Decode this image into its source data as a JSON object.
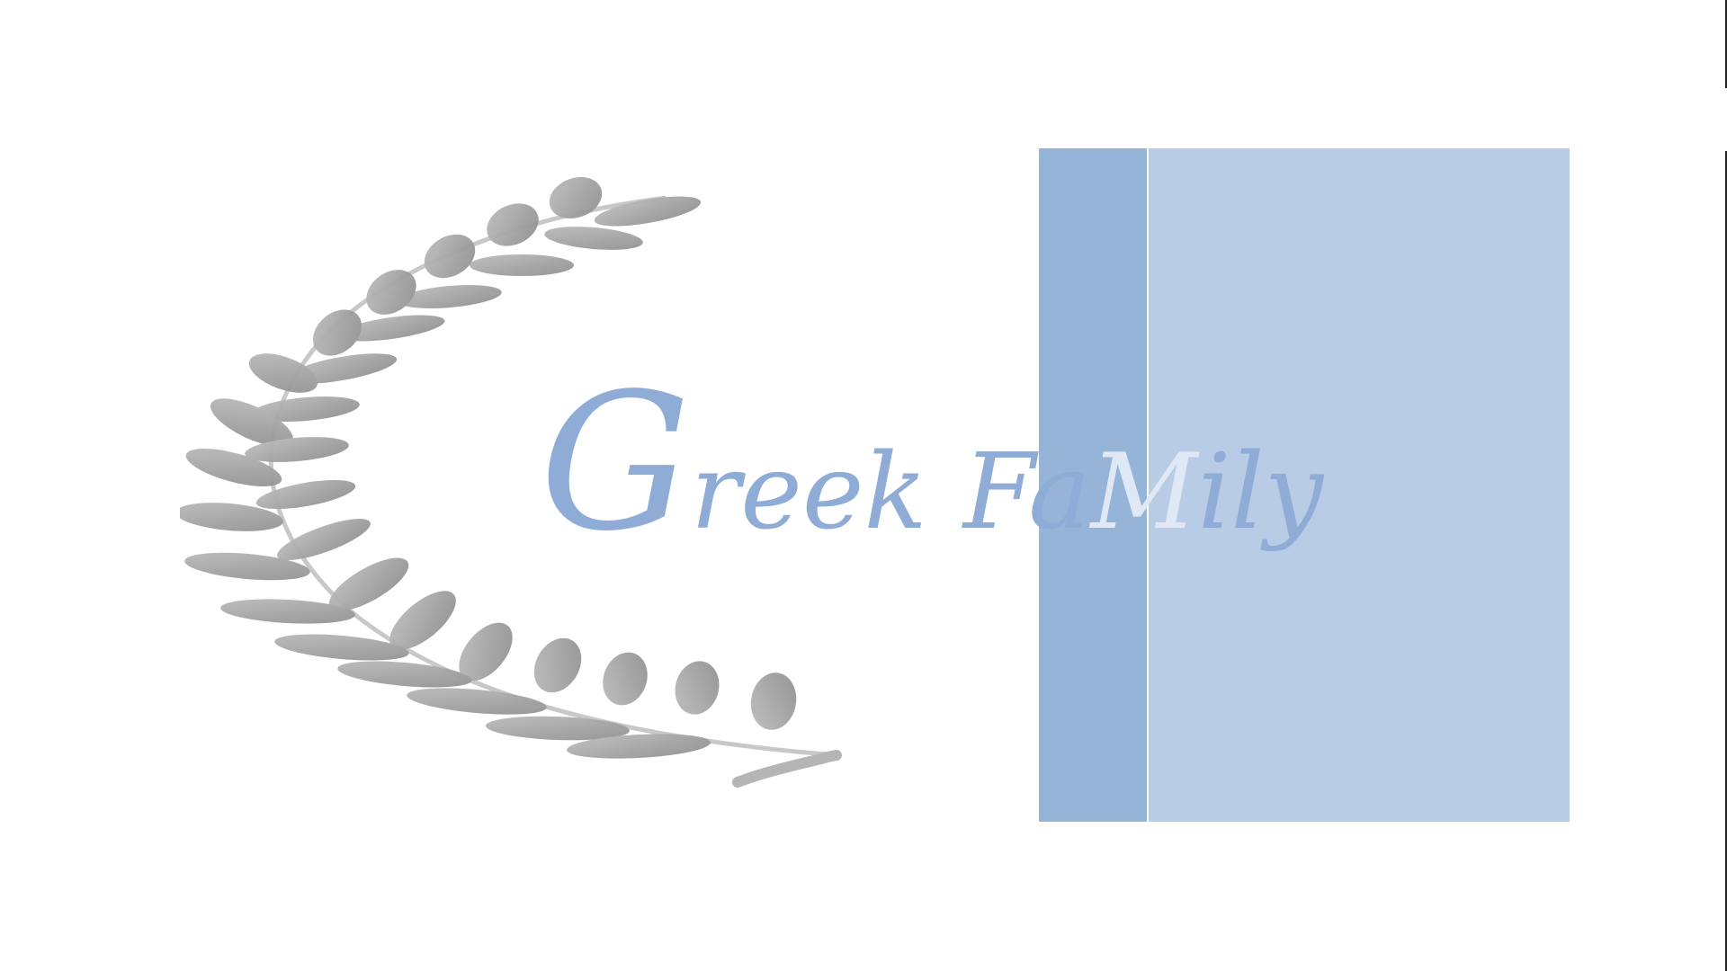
{
  "logo": {
    "text": "Greek Family",
    "first_letter": "G",
    "word1_rest": "reek",
    "word2_start": "Fa",
    "word2_mid": "M",
    "word2_end": "ily"
  },
  "colors": {
    "background": "#ffffff",
    "panel_dark": "#95b4d8",
    "panel_light": "#b8cce5",
    "text": "#8eacd6",
    "laurel": "#a6a6a6"
  },
  "icons": {
    "laurel": "laurel-branch-icon"
  }
}
